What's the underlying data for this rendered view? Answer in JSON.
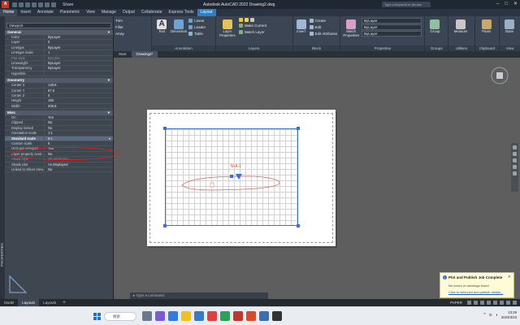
{
  "titlebar": {
    "app_icon": "A",
    "share": "Share",
    "title": "Autodesk AutoCAD 2022   Drawing2.dwg",
    "search_placeholder": "Type a keyword or phrase"
  },
  "ribbon_tabs": [
    "Home",
    "Insert",
    "Annotate",
    "Parametric",
    "View",
    "Manage",
    "Output",
    "Collaborate",
    "Express Tools",
    "Layout"
  ],
  "ribbon": {
    "draw_items": [
      "Trim",
      "Fillet",
      "Array"
    ],
    "line": "Line",
    "text": "Text",
    "dimension": "Dimension",
    "linear": "Linear",
    "leader": "Leader",
    "table": "Table",
    "annotation": "Annotation",
    "layer_properties": "Layer Properties",
    "make_current": "Make Current",
    "match_layer": "Match Layer",
    "layers": "Layers",
    "insert": "Insert",
    "create": "Create",
    "edit": "Edit",
    "edit_attributes": "Edit Attributes",
    "block": "Block",
    "match_properties": "Match Properties",
    "bylayer_1": "ByLayer",
    "bylayer_2": "ByLayer",
    "bylayer_3": "ByLayer",
    "properties": "Properties",
    "group": "Group",
    "groups": "Groups",
    "measure": "Measure",
    "utilities": "Utilities",
    "paste": "Paste",
    "clipboard": "Clipboard",
    "base": "Base",
    "view": "View"
  },
  "doc_tabs": [
    "Start",
    "Drawing2*"
  ],
  "palette": {
    "side_label": "PROPERTIES",
    "object_type": "Viewport",
    "categories": {
      "general": "General",
      "geometry": "Geometry",
      "misc": "Misc"
    },
    "general": [
      {
        "k": "Color",
        "v": "ByLayer"
      },
      {
        "k": "Layer",
        "v": "0"
      },
      {
        "k": "Linetype",
        "v": "ByLayer"
      },
      {
        "k": "Linetype scale",
        "v": "1"
      },
      {
        "k": "Plot style",
        "v": "ByColor"
      },
      {
        "k": "Lineweight",
        "v": "ByLayer"
      },
      {
        "k": "Transparency",
        "v": "ByLayer"
      },
      {
        "k": "Hyperlink",
        "v": ""
      }
    ],
    "geometry": [
      {
        "k": "Center X",
        "v": "128.5"
      },
      {
        "k": "Center Y",
        "v": "87.5"
      },
      {
        "k": "Center Z",
        "v": "0"
      },
      {
        "k": "Height",
        "v": "150"
      },
      {
        "k": "Width",
        "v": "205.8"
      }
    ],
    "misc": [
      {
        "k": "On",
        "v": "Yes"
      },
      {
        "k": "Clipped",
        "v": "No"
      },
      {
        "k": "Display locked",
        "v": "No"
      },
      {
        "k": "Annotation scale",
        "v": "1:1"
      },
      {
        "k": "Standard scale",
        "v": "5:1"
      },
      {
        "k": "Custom scale",
        "v": "5"
      },
      {
        "k": "UCS per viewport",
        "v": "Yes"
      },
      {
        "k": "Layer property overr...",
        "v": "No"
      },
      {
        "k": "Visual style",
        "v": "2D Wireframe"
      },
      {
        "k": "Shade plot",
        "v": "As Displayed"
      },
      {
        "k": "Linked to Sheet View",
        "v": "No"
      }
    ]
  },
  "drawing": {
    "viewport_label": "N-A-1"
  },
  "command": {
    "placeholder": "Type a command"
  },
  "layout_tabs": [
    "Model",
    "Layout1",
    "Layout2"
  ],
  "status": {
    "space": "PAPER"
  },
  "notification": {
    "title": "Plot and Publish Job Complete",
    "message": "No errors or warnings found",
    "link": "Click to view plot and publish details..."
  },
  "taskbar": {
    "search": "搜索",
    "time": "13:29",
    "date": "2023/3/23"
  },
  "colors": {
    "accent": "#2d7ec4",
    "viewport_border": "#3a6fd8",
    "highlight": "#e02020"
  }
}
